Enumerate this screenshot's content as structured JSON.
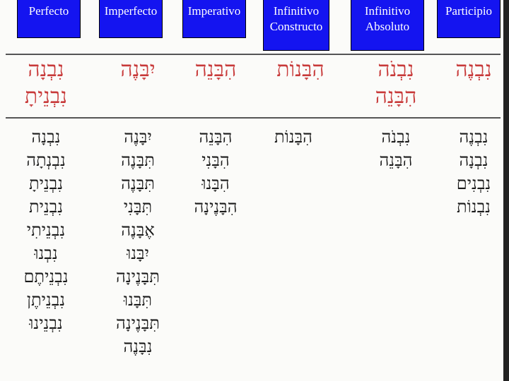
{
  "headers": [
    "Perfecto",
    "Imperfecto",
    "Imperativo",
    "Infinitivo Constructo",
    "Infinitivo Absoluto",
    "Participio"
  ],
  "top_forms": {
    "perfecto": [
      "נִבְנָה",
      "נִבְנֵיתָ"
    ],
    "imperfecto": [
      "יִבָּנֶה"
    ],
    "imperativo": [
      "הִבָּנֵה"
    ],
    "inf_constructo": [
      "הִבָּנוֹת"
    ],
    "inf_absoluto": [
      "נִבְנֹה",
      "הִבָּנֵה"
    ],
    "participio": [
      "נִבְנֶה"
    ]
  },
  "lists": {
    "perfecto": [
      "נִבְנָה",
      "נִבְנְתָה",
      "נִבְנֵיתָ",
      "נִבְנֵית",
      "נִבְנֵיתִי",
      "נִבְנוּ",
      "נִבְנֵיתֶם",
      "נִבְנֵיתֶן",
      "נִבְנֵינוּ"
    ],
    "imperfecto": [
      "יִבָּנֶה",
      "תִּבָּנֶה",
      "תִּבָּנֶה",
      "תִּבָּנִי",
      "אֶבָּנֶה",
      "יִבָּנוּ",
      "תִּבָּנֶינָה",
      "תִּבָּנוּ",
      "תִּבָּנֶינָה",
      "נִבָּנֶה"
    ],
    "imperativo": [
      "הִבָּנֵה",
      "הִבָּנִי",
      "הִבָּנוּ",
      "הִבָּנֶינָה"
    ],
    "inf_constructo": [
      "הִבָּנוֹת"
    ],
    "inf_absoluto": [
      "נִבְנֹה",
      "הִבָּנֵה"
    ],
    "participio": [
      "נִבְנֶה",
      "נִבְנָה",
      "נִבְנִים",
      "נִבְנוֹת"
    ]
  },
  "colors": {
    "header_bg": "#1414f0",
    "accent_red": "#c83a3a"
  }
}
